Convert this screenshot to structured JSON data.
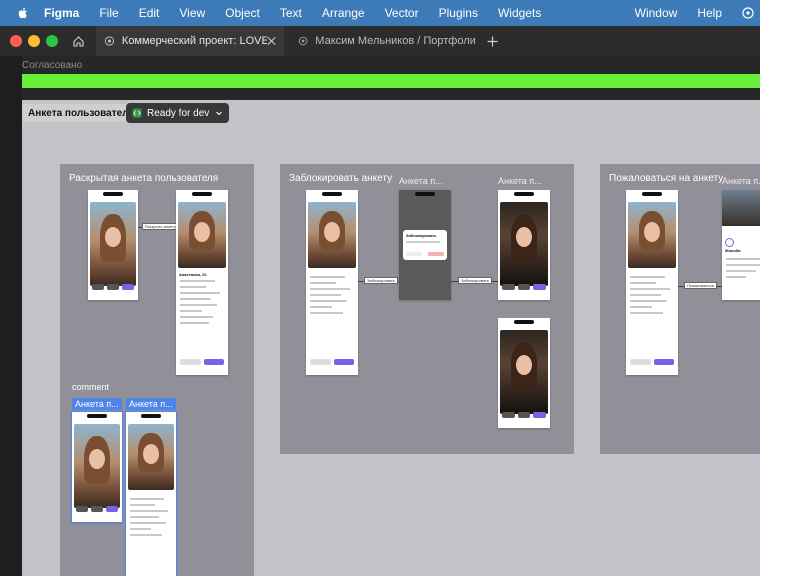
{
  "menubar": {
    "app": "Figma",
    "items": [
      "File",
      "Edit",
      "View",
      "Object",
      "Text",
      "Arrange",
      "Vector",
      "Plugins",
      "Widgets"
    ],
    "right_items": [
      "Window",
      "Help"
    ]
  },
  "tabs": [
    {
      "label": "Коммерческий проект: LOVELY",
      "active": true
    },
    {
      "label": "Максим Мельников / Портфолио (Co"
    }
  ],
  "canvas": {
    "status_label": "Согласовано",
    "frame_name": "Анкета пользователя",
    "dev_status": "Ready for dev",
    "sections": {
      "expanded": "Раскрытая анкета пользователя",
      "block": "Заблокировать анкету",
      "report": "Пожаловаться на анкету"
    },
    "frame_labels": {
      "block_1": "Анкета п...",
      "block_2": "Анкета п...",
      "report_1": "Анкета п...",
      "comment_1": "Анкета п...",
      "comment_2": "Анкета п..."
    },
    "comment_label": "comment",
    "connectors": {
      "expand": "Раскрыть анкету",
      "block": "Заблокировать",
      "block_done": "Заблокировать",
      "report": "Пожаловаться"
    },
    "dialogs": {
      "block_title": "Заблокировать",
      "report_title": "Жалоба"
    },
    "profile": {
      "name": "Анастасия, 22"
    }
  },
  "colors": {
    "menubar": "#3c7ab8",
    "approved_bar": "#66ee3a",
    "canvas": "#c3c2c9",
    "section": "#918f98",
    "accent": "#7b61e8"
  }
}
